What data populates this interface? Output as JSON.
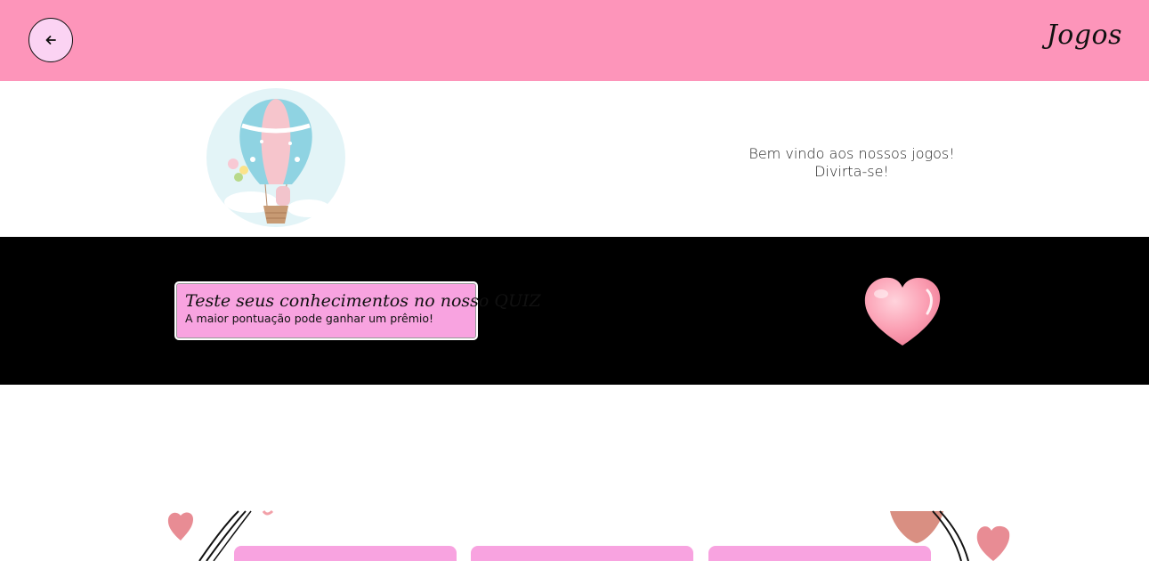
{
  "header": {
    "title": "Jogos",
    "back_icon": "arrow-left-icon",
    "colors": {
      "bar": "#fd95ba",
      "back_button": "#fbd3f3"
    }
  },
  "welcome": {
    "line1": "Bem vindo aos nossos jogos!",
    "line2": "Divirta-se!",
    "image": "hot-air-balloon-illustration"
  },
  "quiz": {
    "title": "Teste seus conhecimentos no nosso QUIZ",
    "subtitle": "A maior pontuação pode ganhar um prêmio!",
    "image": "pink-heart-illustration",
    "colors": {
      "card": "#f8a3e0",
      "section": "#000000"
    }
  },
  "games": {
    "cards": [
      {
        "name": "game-card-1"
      },
      {
        "name": "game-card-2"
      },
      {
        "name": "game-card-3"
      }
    ],
    "decorations": [
      "heart-icon",
      "swirl-lines",
      "balloon-icon"
    ]
  }
}
